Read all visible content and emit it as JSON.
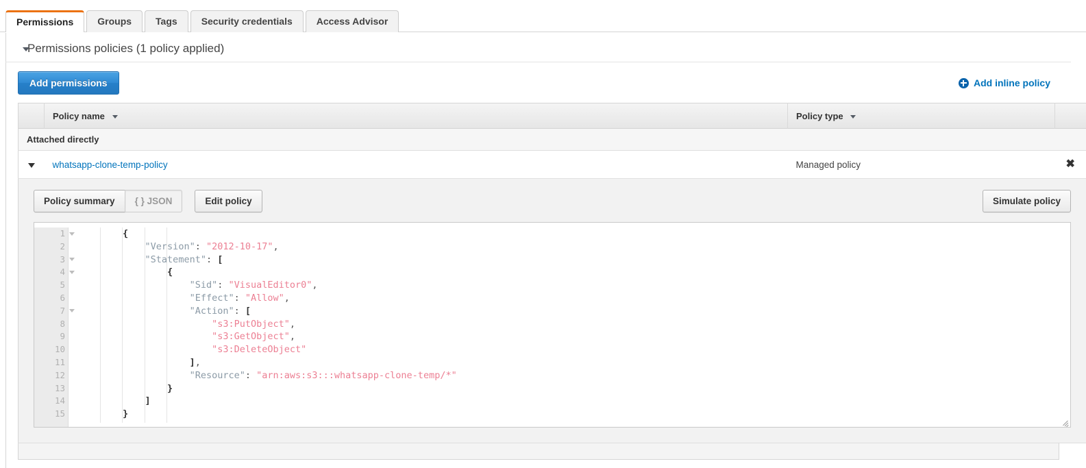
{
  "tabs": [
    {
      "label": "Permissions",
      "active": true
    },
    {
      "label": "Groups",
      "active": false
    },
    {
      "label": "Tags",
      "active": false
    },
    {
      "label": "Security credentials",
      "active": false
    },
    {
      "label": "Access Advisor",
      "active": false
    }
  ],
  "section": {
    "title": "Permissions policies (1 policy applied)"
  },
  "toolbar": {
    "add_permissions_label": "Add permissions",
    "add_inline_policy_label": "Add inline policy",
    "plus_icon": "plus-circle-icon"
  },
  "table": {
    "columns": [
      {
        "label": "Policy name",
        "sortable": true
      },
      {
        "label": "Policy type",
        "sortable": true
      }
    ],
    "group_label": "Attached directly",
    "rows": [
      {
        "policy_name": "whatsapp-clone-temp-policy",
        "policy_type": "Managed policy",
        "remove_icon": "close-x-icon",
        "expanded": true
      }
    ]
  },
  "detail": {
    "buttons": {
      "policy_summary": "Policy summary",
      "json": "{ } JSON",
      "edit_policy": "Edit policy",
      "simulate_policy": "Simulate policy"
    },
    "active_view": "json",
    "editor": {
      "line_count": 15,
      "fold_lines": [
        1,
        3,
        4,
        7
      ],
      "lines": [
        {
          "n": 1,
          "fold": true,
          "tokens": [
            {
              "t": "        ",
              "c": "ws"
            },
            {
              "t": "{",
              "c": "p"
            }
          ]
        },
        {
          "n": 2,
          "fold": false,
          "tokens": [
            {
              "t": "            ",
              "c": "ws"
            },
            {
              "t": "\"Version\"",
              "c": "k"
            },
            {
              "t": ": ",
              "c": "pn"
            },
            {
              "t": "\"2012-10-17\"",
              "c": "s"
            },
            {
              "t": ",",
              "c": "pn"
            }
          ]
        },
        {
          "n": 3,
          "fold": true,
          "tokens": [
            {
              "t": "            ",
              "c": "ws"
            },
            {
              "t": "\"Statement\"",
              "c": "k"
            },
            {
              "t": ": ",
              "c": "pn"
            },
            {
              "t": "[",
              "c": "p"
            }
          ]
        },
        {
          "n": 4,
          "fold": true,
          "tokens": [
            {
              "t": "                ",
              "c": "ws"
            },
            {
              "t": "{",
              "c": "p"
            }
          ]
        },
        {
          "n": 5,
          "fold": false,
          "tokens": [
            {
              "t": "                    ",
              "c": "ws"
            },
            {
              "t": "\"Sid\"",
              "c": "k"
            },
            {
              "t": ": ",
              "c": "pn"
            },
            {
              "t": "\"VisualEditor0\"",
              "c": "s"
            },
            {
              "t": ",",
              "c": "pn"
            }
          ]
        },
        {
          "n": 6,
          "fold": false,
          "tokens": [
            {
              "t": "                    ",
              "c": "ws"
            },
            {
              "t": "\"Effect\"",
              "c": "k"
            },
            {
              "t": ": ",
              "c": "pn"
            },
            {
              "t": "\"Allow\"",
              "c": "s"
            },
            {
              "t": ",",
              "c": "pn"
            }
          ]
        },
        {
          "n": 7,
          "fold": true,
          "tokens": [
            {
              "t": "                    ",
              "c": "ws"
            },
            {
              "t": "\"Action\"",
              "c": "k"
            },
            {
              "t": ": ",
              "c": "pn"
            },
            {
              "t": "[",
              "c": "p"
            }
          ]
        },
        {
          "n": 8,
          "fold": false,
          "tokens": [
            {
              "t": "                        ",
              "c": "ws"
            },
            {
              "t": "\"s3:PutObject\"",
              "c": "s"
            },
            {
              "t": ",",
              "c": "pn"
            }
          ]
        },
        {
          "n": 9,
          "fold": false,
          "tokens": [
            {
              "t": "                        ",
              "c": "ws"
            },
            {
              "t": "\"s3:GetObject\"",
              "c": "s"
            },
            {
              "t": ",",
              "c": "pn"
            }
          ]
        },
        {
          "n": 10,
          "fold": false,
          "tokens": [
            {
              "t": "                        ",
              "c": "ws"
            },
            {
              "t": "\"s3:DeleteObject\"",
              "c": "s"
            }
          ]
        },
        {
          "n": 11,
          "fold": false,
          "tokens": [
            {
              "t": "                    ",
              "c": "ws"
            },
            {
              "t": "]",
              "c": "p"
            },
            {
              "t": ",",
              "c": "pn"
            }
          ]
        },
        {
          "n": 12,
          "fold": false,
          "tokens": [
            {
              "t": "                    ",
              "c": "ws"
            },
            {
              "t": "\"Resource\"",
              "c": "k"
            },
            {
              "t": ": ",
              "c": "pn"
            },
            {
              "t": "\"arn:aws:s3:::whatsapp-clone-temp/*\"",
              "c": "s"
            }
          ]
        },
        {
          "n": 13,
          "fold": false,
          "tokens": [
            {
              "t": "                ",
              "c": "ws"
            },
            {
              "t": "}",
              "c": "p"
            }
          ]
        },
        {
          "n": 14,
          "fold": false,
          "tokens": [
            {
              "t": "            ",
              "c": "ws"
            },
            {
              "t": "]",
              "c": "p"
            }
          ]
        },
        {
          "n": 15,
          "fold": false,
          "tokens": [
            {
              "t": "        ",
              "c": "ws"
            },
            {
              "t": "}",
              "c": "p"
            }
          ]
        }
      ]
    }
  },
  "colors": {
    "aws_orange": "#ec7211",
    "link_blue": "#0073bb",
    "button_blue": "#2f8ad4",
    "json_key": "#8b9aa6",
    "json_string": "#ec7f93"
  }
}
